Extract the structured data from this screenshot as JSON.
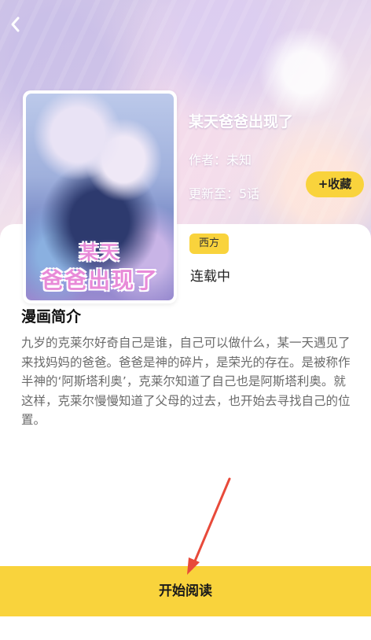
{
  "header": {
    "back_icon": "chevron-left-icon"
  },
  "comic": {
    "title": "某天爸爸出现了",
    "cover_title_line1": "某天",
    "cover_title_line2": "爸爸出现了",
    "author": "作者：未知",
    "update": "更新至：5话",
    "tag": "西方",
    "status": "连载中"
  },
  "actions": {
    "collect_label": "+收藏",
    "read_label": "开始阅读"
  },
  "intro": {
    "heading": "漫画简介",
    "text": "九岁的克莱尔好奇自己是谁，自己可以做什么，某一天遇见了来找妈妈的爸爸。爸爸是神的碎片，是荣光的存在。是被称作半神的‘阿斯塔利奥’，克莱尔知道了自己也是阿斯塔利奥。就这样，克莱尔慢慢知道了父母的过去，也开始去寻找自己的位置。"
  },
  "colors": {
    "accent": "#f9d33c",
    "annotation_arrow": "#e84a3a"
  }
}
